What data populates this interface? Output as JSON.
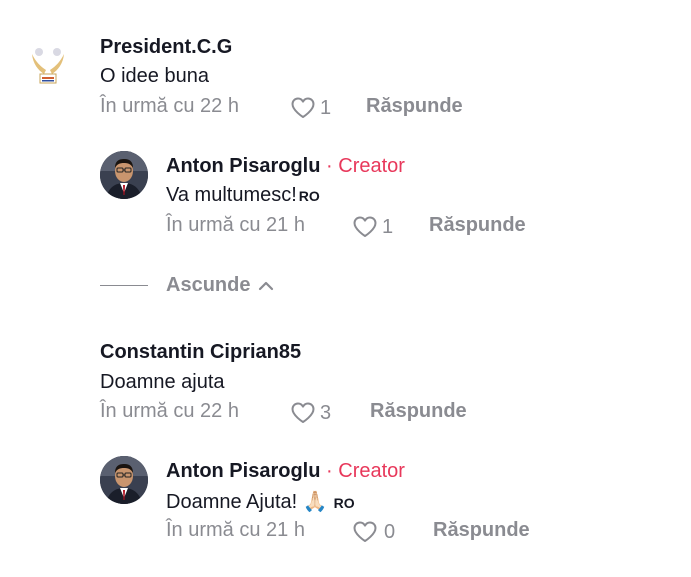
{
  "comments": [
    {
      "author": "President.C.G",
      "text": "O idee buna",
      "time": "În urmă cu 22 h",
      "likes": "1",
      "reply_label": "Răspunde",
      "avatar": "logo-avatar"
    },
    {
      "author": "Constantin Ciprian85",
      "text": "Doamne ajuta",
      "time": "În urmă cu 22 h",
      "likes": "3",
      "reply_label": "Răspunde"
    }
  ],
  "replies": [
    {
      "author": "Anton Pisaroglu",
      "separator": "·",
      "badge": "Creator",
      "text": "Va multumesc!",
      "lang": "RO",
      "time": "În urmă cu 21 h",
      "likes": "1",
      "reply_label": "Răspunde",
      "avatar": "person-avatar"
    },
    {
      "author": "Anton Pisaroglu",
      "separator": "·",
      "badge": "Creator",
      "text": "Doamne Ajuta! 🙏🏻",
      "lang": "RO",
      "time": "În urmă cu 21 h",
      "likes": "0",
      "reply_label": "Răspunde",
      "avatar": "person-avatar"
    }
  ],
  "hide_replies_label": "Ascunde",
  "colors": {
    "creator": "#e8385b",
    "muted": "#8a8b91",
    "text": "#161823"
  }
}
